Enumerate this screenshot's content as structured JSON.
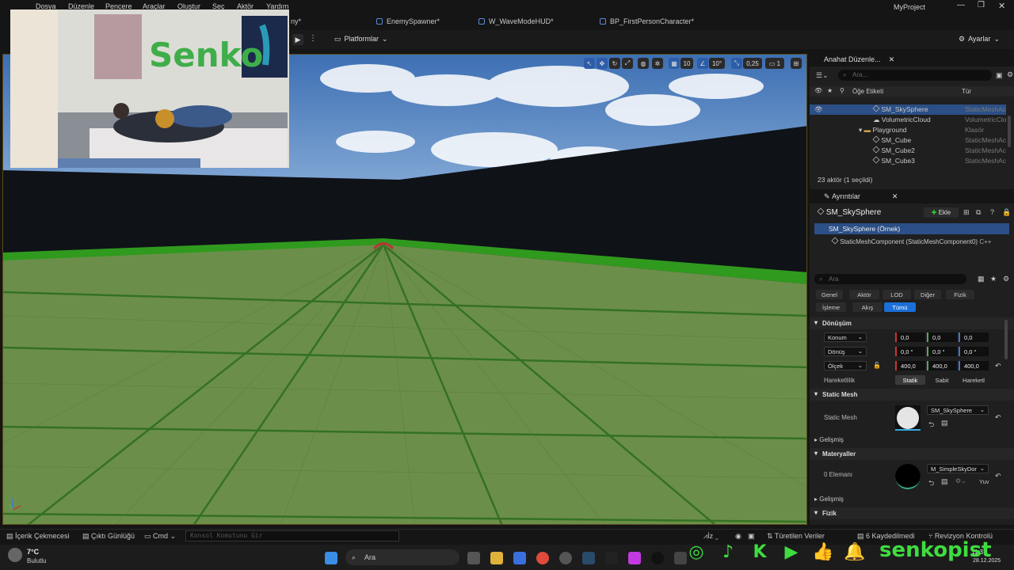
{
  "app": {
    "title": "MyProject"
  },
  "menu": [
    "Dosya",
    "Düzenle",
    "Pencere",
    "Araçlar",
    "Oluştur",
    "Seç",
    "Aktör",
    "Yardım"
  ],
  "tabs": [
    {
      "label": "ny*"
    },
    {
      "label": "EnemySpawner*"
    },
    {
      "label": "W_WaveModeHUD*"
    },
    {
      "label": "BP_FirstPersonCharacter*"
    }
  ],
  "toolbar": {
    "platforms": "Platformlar",
    "settings": "Ayarlar"
  },
  "viewport_tools": {
    "grid": "10",
    "angle": "10°",
    "scale": "0,25",
    "camera": "1"
  },
  "outliner": {
    "title": "Anahat Düzenle...",
    "search_placeholder": "Ara...",
    "col_label": "Öğe Etiketi",
    "col_type": "Tür",
    "rows": [
      {
        "name": "SM_SkySphere",
        "type": "StaticMeshAc",
        "selected": true
      },
      {
        "name": "VolumetricCloud",
        "type": "VolumetricClo"
      },
      {
        "name": "Playground",
        "type": "Klasör"
      },
      {
        "name": "SM_Cube",
        "type": "StaticMeshAc"
      },
      {
        "name": "SM_Cube2",
        "type": "StaticMeshAc"
      },
      {
        "name": "SM_Cube3",
        "type": "StaticMeshAc"
      }
    ],
    "count": "23 aktör (1 seçildi)"
  },
  "details": {
    "title": "Ayrıntılar",
    "actor": "SM_SkySphere",
    "add": "Ekle",
    "instance": "SM_SkySphere (Örnek)",
    "component": "StaticMeshComponent (StaticMeshComponent0)",
    "component_tag": "C++",
    "search_placeholder": "Ara",
    "filters_row1": [
      "Genel",
      "Aktör",
      "LOD",
      "Diğer",
      "Fizik"
    ],
    "filters_row2": [
      "İşleme",
      "Akış",
      "Tümü"
    ],
    "transform": {
      "section": "Dönüşüm",
      "location": {
        "label": "Konum",
        "x": "0,0",
        "y": "0,0",
        "z": "0,0"
      },
      "rotation": {
        "label": "Dönüş",
        "x": "0,0 °",
        "y": "0,0 °",
        "z": "0,0 °"
      },
      "scale": {
        "label": "Ölçek",
        "x": "400,0",
        "y": "400,0",
        "z": "400,0"
      },
      "mobility": {
        "label": "Hareketlilik",
        "options": [
          "Statik",
          "Sabit",
          "Hareketl"
        ]
      }
    },
    "static_mesh": {
      "section": "Static Mesh",
      "label": "Static Mesh",
      "value": "SM_SkySphere"
    },
    "advanced": "Gelişmiş",
    "materials": {
      "section": "Materyaller",
      "label": "0 Elemanı",
      "value": "M_SimpleSkyDor",
      "extra": "Yuv"
    },
    "advanced2": "Gelişmiş",
    "physics": "Fizik"
  },
  "statusbar": {
    "content_drawer": "İçerik Çekmecesi",
    "output_log": "Çıktı Günlüğü",
    "cmd": "Cmd",
    "console_placeholder": "Konsol Komutunu Gir",
    "derived": "Türetilen Veriler",
    "saved": "6 Kaydedilmedi",
    "revision": "Revizyon Kontrolü",
    "trace": "İz"
  },
  "taskbar": {
    "weather_temp": "7°C",
    "weather_desc": "Bulutlu",
    "search": "Ara",
    "time": "11:37",
    "date": "28.12.2025"
  },
  "overlay": {
    "channel": "senkopist"
  },
  "colors": {
    "accent": "#1b6fd8",
    "selection": "#2b4f86",
    "grass": "#6b8f4a",
    "social_green": "#3fdc3f"
  }
}
